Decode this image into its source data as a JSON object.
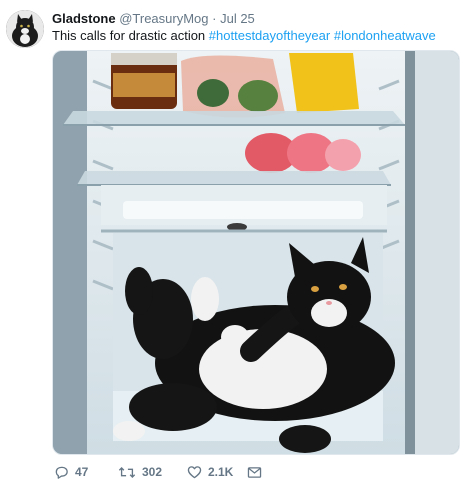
{
  "tweet": {
    "author_name": "Gladstone",
    "author_handle": "@TreasuryMog",
    "separator": "·",
    "date": "Jul 25",
    "text": "This calls for drastic action",
    "hashtags": [
      "#hottestdayoftheyear",
      "#londonheatwave"
    ]
  },
  "actions": {
    "reply_count": "47",
    "retweet_count": "302",
    "like_count": "2.1K"
  },
  "icons": {
    "reply": "reply-icon",
    "retweet": "retweet-icon",
    "like": "heart-icon",
    "dm": "envelope-icon"
  },
  "colors": {
    "link": "#1da1f2",
    "muted": "#657786",
    "text": "#14171a"
  }
}
